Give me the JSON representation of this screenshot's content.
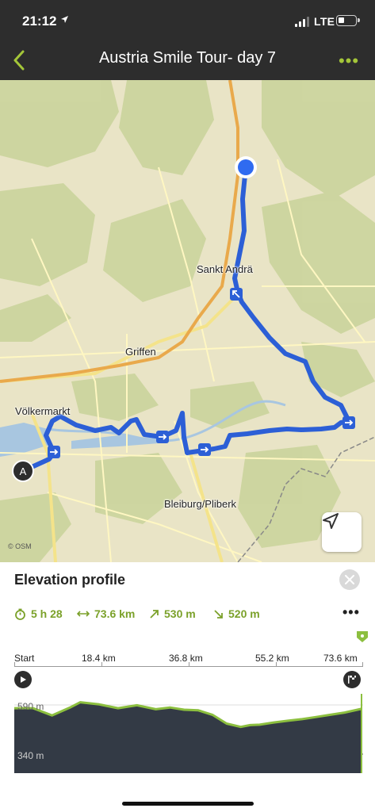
{
  "status_bar": {
    "time": "21:12",
    "network": "LTE"
  },
  "nav": {
    "title": "Austria Smile Tour- day 7",
    "more_label": "•••"
  },
  "map": {
    "labels": {
      "sankt_andra": "Sankt Andrä",
      "griffen": "Griffen",
      "volkermarkt": "Völkermarkt",
      "bleiburg": "Bleiburg/Pliberk"
    },
    "start_marker": "A",
    "attribution": "© OSM",
    "route_color": "#2c5fd6"
  },
  "elevation": {
    "heading": "Elevation profile",
    "stats": {
      "duration": "5 h 28",
      "distance": "73.6 km",
      "ascent": "530 m",
      "descent": "520 m"
    },
    "more_label": "•••",
    "axis_labels": [
      "Start",
      "18.4 km",
      "36.8 km",
      "55.2 km",
      "73.6 km"
    ],
    "y_labels": {
      "top": "590 m",
      "bottom": "340 m"
    },
    "accent_color": "#7ba12a"
  },
  "chart_data": {
    "type": "area",
    "title": "Elevation profile",
    "xlabel": "",
    "ylabel": "",
    "x": [
      0,
      4,
      8,
      12,
      14,
      18,
      22,
      26,
      30,
      33,
      36,
      39,
      42,
      45,
      48,
      50,
      52,
      55,
      58,
      61,
      64,
      67,
      70,
      73.6
    ],
    "values": [
      575,
      575,
      542,
      580,
      602,
      592,
      575,
      588,
      570,
      578,
      568,
      565,
      545,
      505,
      490,
      498,
      500,
      510,
      518,
      525,
      535,
      545,
      555,
      572
    ],
    "xlim": [
      0,
      73.6
    ],
    "ylim": [
      280,
      640
    ],
    "x_ticks": [
      "Start",
      "18.4 km",
      "36.8 km",
      "55.2 km",
      "73.6 km"
    ],
    "y_ticks": [
      "590 m",
      "340 m"
    ]
  }
}
